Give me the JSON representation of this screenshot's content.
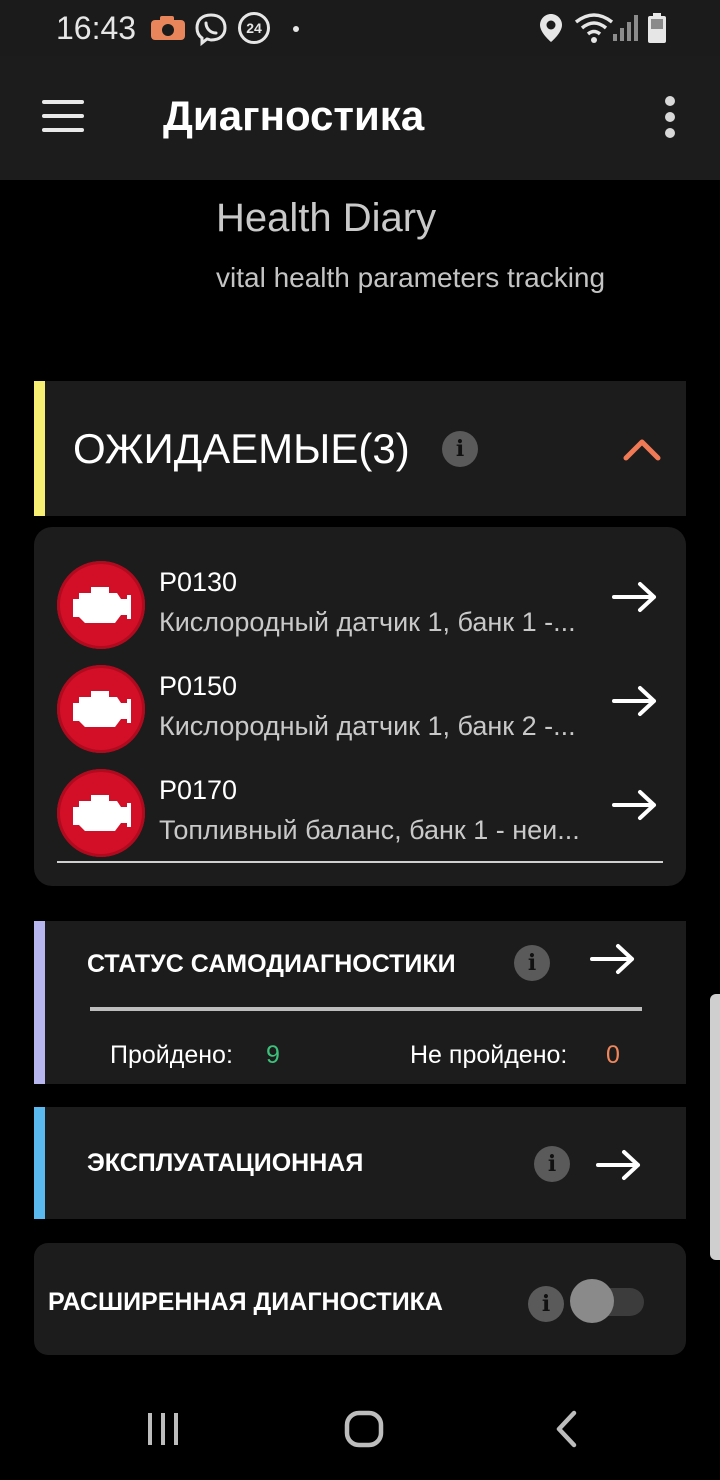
{
  "status_bar": {
    "time": "16:43",
    "badge_24": "24",
    "icons": [
      "camera-notification-icon",
      "viber-icon",
      "badge-24-icon",
      "dot-icon",
      "location-icon",
      "wifi-icon",
      "signal-icon",
      "battery-icon"
    ]
  },
  "app_bar": {
    "title": "Диагностика"
  },
  "promo": {
    "title": "Health Diary",
    "subtitle": "vital health parameters tracking"
  },
  "expected": {
    "title": "ОЖИДАЕМЫЕ(3)",
    "accent_color": "#f6ef74",
    "chevron_color": "#f07a56",
    "codes": [
      {
        "code": "P0130",
        "description": "Кислородный датчик 1, банк 1 -..."
      },
      {
        "code": "P0150",
        "description": "Кислородный датчик 1, банк 2 -..."
      },
      {
        "code": "P0170",
        "description": "Топливный баланс, банк 1 - неи..."
      }
    ]
  },
  "self_diagnostics": {
    "title": "СТАТУС САМОДИАГНОСТИКИ",
    "accent_color": "#b8b6ee",
    "passed_label": "Пройдено:",
    "passed_value": "9",
    "passed_color": "#3cc07a",
    "failed_label": "Не пройдено:",
    "failed_value": "0",
    "failed_color": "#f0875c"
  },
  "operational": {
    "title": "ЭКСПЛУАТАЦИОННАЯ",
    "accent_color": "#5ab9ee"
  },
  "extended": {
    "title": "РАСШИРЕННАЯ ДИАГНОСТИКА",
    "toggle_on": false
  },
  "info_glyph": "i"
}
